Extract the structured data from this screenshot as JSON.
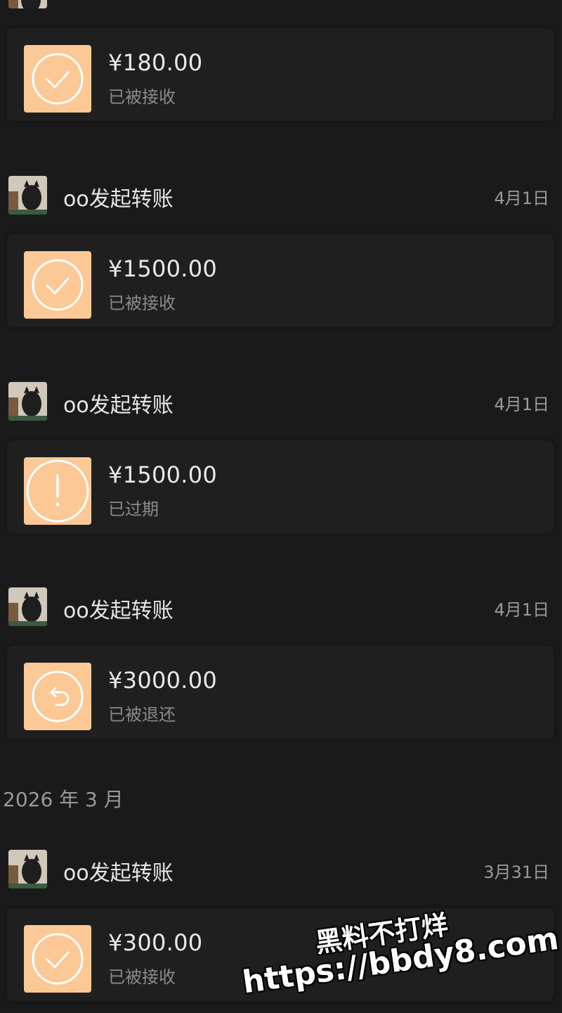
{
  "month_header": "2026 年 3 月",
  "transfers": [
    {
      "title": "",
      "date": "",
      "amount": "¥180.00",
      "status": "已被接收",
      "icon": "check-circle-icon"
    },
    {
      "title": "oo发起转账",
      "date": "4月1日",
      "amount": "¥1500.00",
      "status": "已被接收",
      "icon": "check-circle-icon"
    },
    {
      "title": "oo发起转账",
      "date": "4月1日",
      "amount": "¥1500.00",
      "status": "已过期",
      "icon": "exclamation-circle-icon"
    },
    {
      "title": "oo发起转账",
      "date": "4月1日",
      "amount": "¥3000.00",
      "status": "已被退还",
      "icon": "return-arrow-circle-icon"
    },
    {
      "title": "oo发起转账",
      "date": "3月31日",
      "amount": "¥300.00",
      "status": "已被接收",
      "icon": "check-circle-icon"
    }
  ],
  "watermark": {
    "line1": "黑料不打烊",
    "line2": "https://bbdy8.com"
  },
  "colors": {
    "background": "#1a1a1b",
    "card": "#1f1f20",
    "icon_bg": "#fbc896"
  }
}
